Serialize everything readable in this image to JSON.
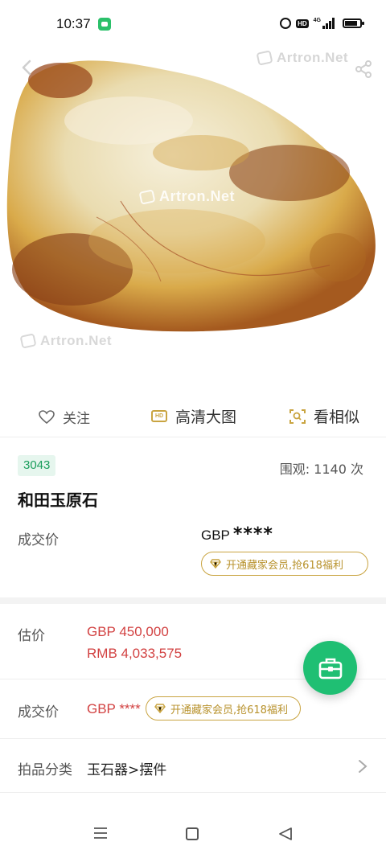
{
  "status_bar": {
    "time": "10:37",
    "hd": "HD",
    "network": "4G"
  },
  "hero": {
    "watermark": "Artron.Net",
    "stone_colors": [
      "#efe6c7",
      "#d3992e",
      "#9d4a1c"
    ]
  },
  "actions": {
    "follow_label": "关注",
    "hd_label": "高清大图",
    "similar_label": "看相似"
  },
  "lot": {
    "number": "3043",
    "views": "围观: 1140 次",
    "title": "和田玉原石",
    "price_label": "成交价",
    "price_currency": "GBP",
    "price_masked": "****",
    "member_promo": "开通藏家会员,抢618福利"
  },
  "details": {
    "estimate_label": "估价",
    "estimate_gbp": "GBP  450,000",
    "estimate_rmb": "RMB 4,033,575",
    "price_label": "成交价",
    "price_value": "GBP ****",
    "member_promo": "开通藏家会员,抢618福利",
    "category_label": "拍品分类",
    "category_value": "玉石器>摆件"
  },
  "colors": {
    "accent_green": "#1fbf73",
    "price_red": "#d24141",
    "gold": "#c9a441"
  }
}
